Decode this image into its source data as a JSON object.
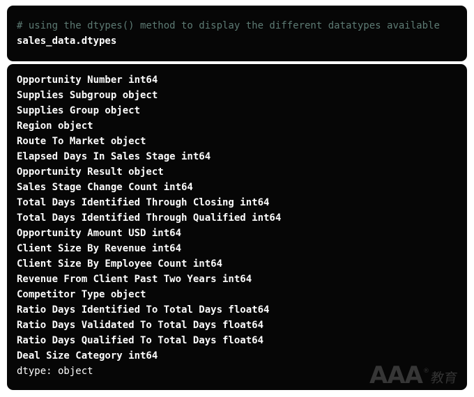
{
  "cell": {
    "comment": "# using the dtypes() method to display the different datatypes available",
    "statement": "sales_data.dtypes",
    "comment_color": "#5d7a73",
    "statement_color": "#ffffff",
    "background_color": "#060606"
  },
  "output": {
    "background_color": "#060606",
    "text_color": "#fcfcfc",
    "lines": [
      "Opportunity Number int64",
      "Supplies Subgroup object",
      "Supplies Group object",
      "Region object",
      "Route To Market object",
      "Elapsed Days In Sales Stage int64",
      "Opportunity Result object",
      "Sales Stage Change Count int64",
      "Total Days Identified Through Closing int64",
      "Total Days Identified Through Qualified int64",
      "Opportunity Amount USD int64",
      "Client Size By Revenue int64",
      "Client Size By Employee Count int64",
      "Revenue From Client Past Two Years int64",
      "Competitor Type object",
      "Ratio Days Identified To Total Days float64",
      "Ratio Days Validated To Total Days float64",
      "Ratio Days Qualified To Total Days float64",
      "Deal Size Category int64"
    ],
    "footer": "dtype: object"
  },
  "watermark": {
    "mark": "AAA",
    "registered": "®",
    "subtitle": "教育",
    "color": "#3c3c3c"
  }
}
